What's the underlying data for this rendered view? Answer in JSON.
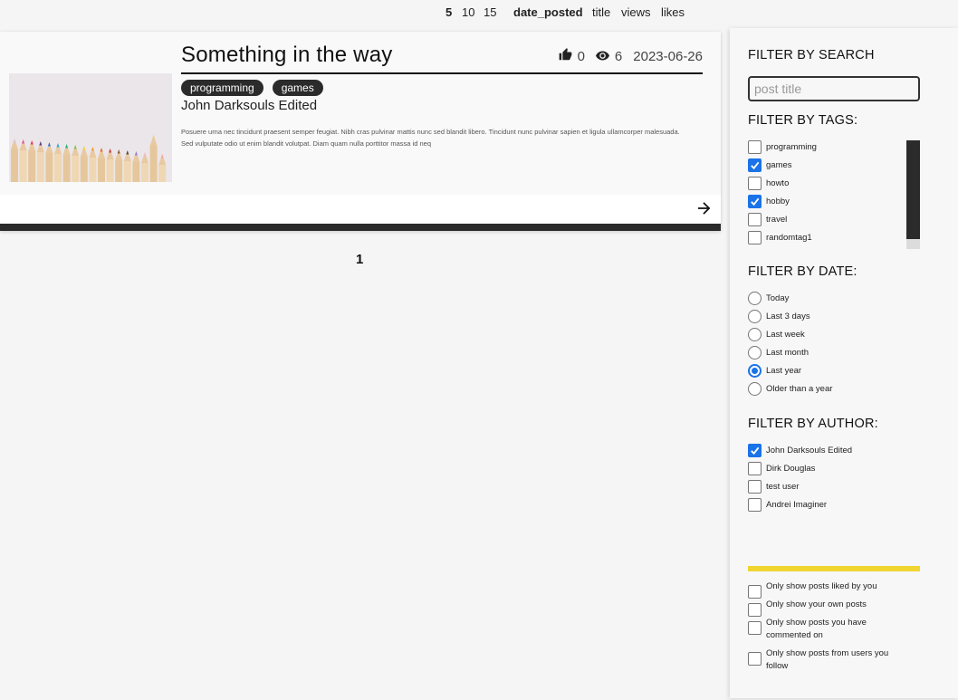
{
  "sort_bar": {
    "page_sizes": [
      "5",
      "10",
      "15"
    ],
    "selected_page_size": "5",
    "sort_options": [
      "date_posted",
      "title",
      "views",
      "likes"
    ],
    "selected_sort": "date_posted"
  },
  "post": {
    "title": "Something in the way",
    "likes": "0",
    "views": "6",
    "date": "2023-06-26",
    "tags": [
      "programming",
      "games"
    ],
    "author": "John Darksouls Edited",
    "excerpt": "Posuere urna nec tincidunt praesent semper feugiat. Nibh cras pulvinar mattis nunc sed blandit libero. Tincidunt nunc pulvinar sapien et ligula ullamcorper malesuada. Sed vulputate odio ut enim blandit volutpat. Diam quam nulla porttitor massa id neq"
  },
  "pagination": {
    "current_page": "1"
  },
  "sidebar": {
    "search_heading": "FILTER BY SEARCH",
    "search_placeholder": "post title",
    "tags_heading": "FILTER BY TAGS:",
    "tags": [
      {
        "label": "programming",
        "checked": false
      },
      {
        "label": "games",
        "checked": true
      },
      {
        "label": "howto",
        "checked": false
      },
      {
        "label": "hobby",
        "checked": true
      },
      {
        "label": "travel",
        "checked": false
      },
      {
        "label": "randomtag1",
        "checked": false
      }
    ],
    "date_heading": "FILTER BY DATE:",
    "dates": [
      {
        "label": "Today",
        "checked": false
      },
      {
        "label": "Last 3 days",
        "checked": false
      },
      {
        "label": "Last week",
        "checked": false
      },
      {
        "label": "Last month",
        "checked": false
      },
      {
        "label": "Last year",
        "checked": true
      },
      {
        "label": "Older than a year",
        "checked": false
      }
    ],
    "author_heading": "FILTER BY AUTHOR:",
    "authors": [
      {
        "label": "John Darksouls Edited",
        "checked": true
      },
      {
        "label": "Dirk Douglas",
        "checked": false
      },
      {
        "label": "test user",
        "checked": false
      },
      {
        "label": "Andrei Imaginer",
        "checked": false
      }
    ],
    "extra_filters": [
      {
        "label": "Only show posts liked by you",
        "checked": false
      },
      {
        "label": "Only show your own posts",
        "checked": false
      },
      {
        "label": "Only show posts you have commented on",
        "checked": false
      },
      {
        "label": "Only show posts from users you follow",
        "checked": false
      }
    ]
  },
  "colors": {
    "accent": "#1a73e8",
    "tag_bg": "#2b2b2b",
    "yellow_divider": "#f0d530"
  },
  "icons": [
    "thumbs-up-icon",
    "eye-icon",
    "arrow-right-icon",
    "checkmark-icon"
  ]
}
